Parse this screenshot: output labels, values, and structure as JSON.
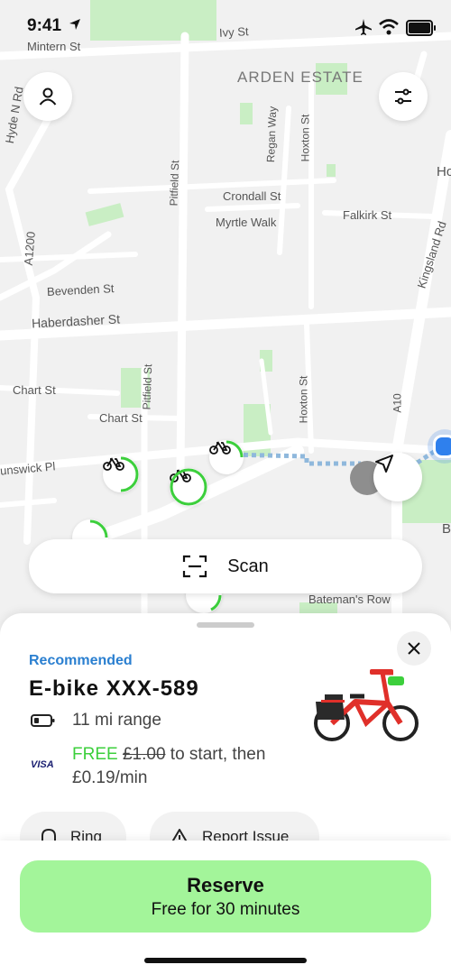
{
  "status_bar": {
    "time": "9:41"
  },
  "map": {
    "streets": [
      "Mintern St",
      "Ivy St",
      "ARDEN ESTATE",
      "Regan Way",
      "Hoxton St",
      "Pitfield St",
      "Crondall St",
      "Myrtle Walk",
      "Falkirk St",
      "Kingsland Rd",
      "A1200",
      "Bevenden St",
      "Haberdasher St",
      "Chart St",
      "Chart St",
      "Pitfield St",
      "Hoxton St",
      "A10",
      "unswick Pl",
      "Bateman's Row",
      "Ho",
      "B",
      "Hyde N Rd"
    ]
  },
  "scan": {
    "label": "Scan"
  },
  "sheet": {
    "recommended": "Recommended",
    "bike_name": "E-bike XXX-589",
    "range": "11 mi range",
    "card_brand": "VISA",
    "price_free": "FREE",
    "price_old": "£1.00",
    "price_rest": "to start, then £0.19/min",
    "ring_label": "Ring",
    "report_label": "Report Issue"
  },
  "reserve": {
    "title": "Reserve",
    "subtitle": "Free for 30 minutes"
  },
  "colors": {
    "accent_green": "#3ccf3c",
    "reserve_bg": "#a3f59a",
    "link_blue": "#2a7fd0"
  }
}
